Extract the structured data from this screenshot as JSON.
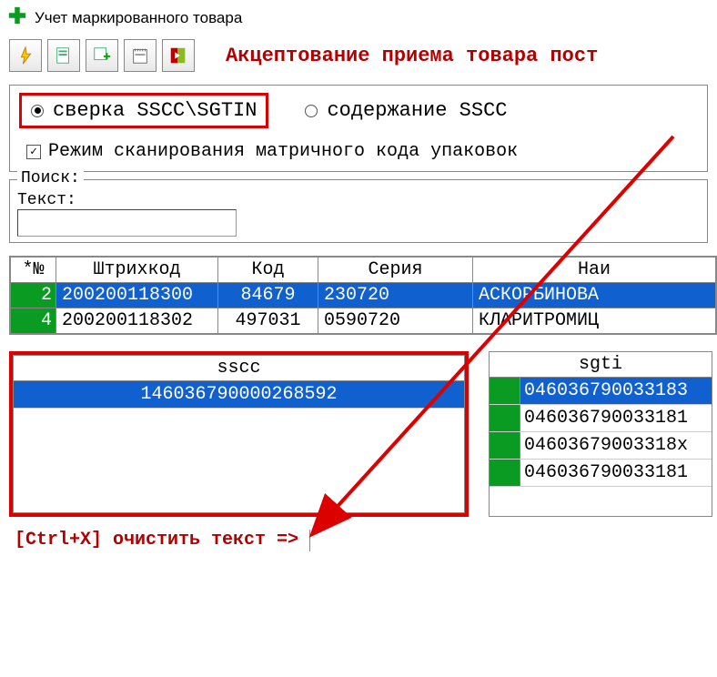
{
  "title": "Учет маркированного товара",
  "toolbar_title": "Акцептование приема товара пост",
  "radio1_label": "сверка SSCC\\SGTIN",
  "radio2_label": "содержание  SSCC",
  "checkbox_label": "Режим сканирования матричного кода упаковок",
  "search": {
    "legend": "Поиск:",
    "text_label": "Текст:",
    "value": ""
  },
  "table": {
    "headers": [
      "*№",
      "Штрихкод",
      "Код",
      "Серия",
      "Наи"
    ],
    "rows": [
      {
        "n": "2",
        "barcode": "200200118300",
        "code": "84679",
        "series": "230720",
        "name": "АСКОРБИНОВА",
        "selected": true
      },
      {
        "n": "4",
        "barcode": "200200118302",
        "code": "497031",
        "series": "0590720",
        "name": "КЛАРИТРОМИЦ",
        "selected": false
      }
    ]
  },
  "sscc": {
    "header": "sscc",
    "rows": [
      {
        "val": "146036790000268592",
        "selected": true
      }
    ]
  },
  "sgtin": {
    "header": "sgti",
    "rows": [
      {
        "val": "046036790033183",
        "selected": true
      },
      {
        "val": "046036790033181",
        "selected": false
      },
      {
        "val": "04603679003318x",
        "selected": false
      },
      {
        "val": "046036790033181",
        "selected": false
      }
    ]
  },
  "footer": "[Ctrl+X] очистить текст =>"
}
